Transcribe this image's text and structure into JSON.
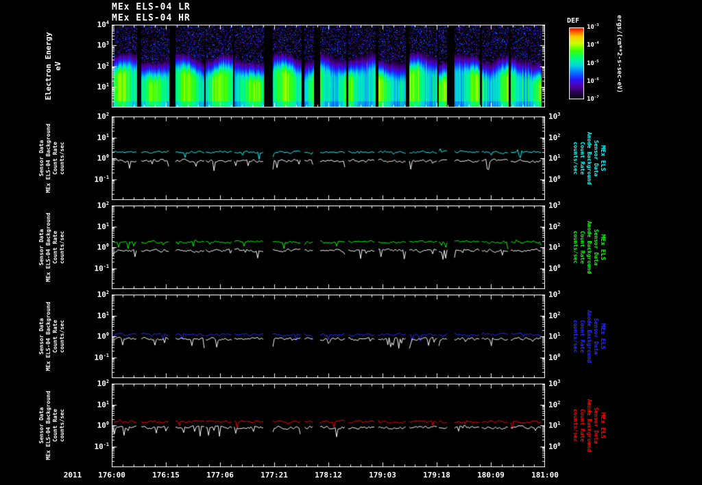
{
  "titles": {
    "lr": "MEx ELS-04 LR",
    "hr": "MEx ELS-04 HR"
  },
  "chart_data": {
    "layout": "5 stacked time-series panels sharing one x axis (day:hour of 2011)",
    "x_axis": {
      "year": "2011",
      "tick_labels": [
        "176:00",
        "176:15",
        "177:06",
        "177:21",
        "178:12",
        "179:03",
        "179:18",
        "180:09",
        "181:00"
      ]
    },
    "time_segments": [
      [
        0.003,
        0.059
      ],
      [
        0.068,
        0.133
      ],
      [
        0.147,
        0.214
      ],
      [
        0.217,
        0.28
      ],
      [
        0.283,
        0.351
      ],
      [
        0.372,
        0.438
      ],
      [
        0.445,
        0.467
      ],
      [
        0.481,
        0.541
      ],
      [
        0.546,
        0.609
      ],
      [
        0.615,
        0.679
      ],
      [
        0.687,
        0.752
      ],
      [
        0.755,
        0.774
      ],
      [
        0.791,
        0.85
      ],
      [
        0.854,
        0.916
      ],
      [
        0.921,
        0.992
      ]
    ],
    "spectrogram": {
      "type": "heatmap",
      "axis_title_lines": [
        "Electron Energy",
        "eV"
      ],
      "y_tick_labels": [
        "10^4",
        "10^3",
        "10^2",
        "10^1"
      ],
      "y_range_log10_eV": [
        0,
        4
      ],
      "flux_profile": {
        "bright_band_log10_eV_range": [
          0,
          1.5
        ],
        "peak_energy_log10_eV": 1.0,
        "falloff_sigma_log10": 0.55,
        "speckle_noise_above_log10_eV": 2.4
      },
      "colorbar": {
        "label": "DEF",
        "tick_labels": [
          "10^-3",
          "10^-4",
          "10^-5",
          "10^-6",
          "10^-7"
        ],
        "unit": "ergs/(cm**2-s-sec-eV)",
        "range_log10": [
          -7,
          -3
        ]
      }
    },
    "line_panels": [
      {
        "type": "line",
        "color": "#00ffff",
        "left_tick_labels": [
          "10^2",
          "10^1",
          "10^0",
          "10^-1"
        ],
        "right_tick_labels": [
          "10^3",
          "10^2",
          "10^1",
          "10^0"
        ],
        "left_axis_title_lines": [
          "Sensor Data",
          "MEx ELS-04 Background",
          "Count Rate",
          "counts/sec"
        ],
        "right_axis_title_lines": [
          "MEx ELS",
          "Sensor Data",
          "Anode Background",
          "Count Rate",
          "counts/sec"
        ],
        "series": [
          {
            "name": "anode background count rate",
            "color": "#00ffff",
            "approx_level_counts_per_sec": 2.0
          },
          {
            "name": "sensor background count rate",
            "color": "#ffffff",
            "approx_level_counts_per_sec": 0.75
          }
        ]
      },
      {
        "type": "line",
        "color": "#00ff00",
        "left_tick_labels": [
          "10^2",
          "10^1",
          "10^0",
          "10^-1"
        ],
        "right_tick_labels": [
          "10^3",
          "10^2",
          "10^1",
          "10^0"
        ],
        "left_axis_title_lines": [
          "Sensor Data",
          "MEx ELS-04 Background",
          "Count Rate",
          "counts/sec"
        ],
        "right_axis_title_lines": [
          "MEx ELS",
          "Sensor Data",
          "Anode Background",
          "Count Rate",
          "counts/sec"
        ],
        "series": [
          {
            "name": "anode background count rate",
            "color": "#00ff00",
            "approx_level_counts_per_sec": 1.8
          },
          {
            "name": "sensor background count rate",
            "color": "#ffffff",
            "approx_level_counts_per_sec": 0.7
          }
        ]
      },
      {
        "type": "line",
        "color": "#2a2aff",
        "left_tick_labels": [
          "10^2",
          "10^1",
          "10^0",
          "10^-1"
        ],
        "right_tick_labels": [
          "10^3",
          "10^2",
          "10^1",
          "10^0"
        ],
        "left_axis_title_lines": [
          "Sensor Data",
          "MEx ELS-04 Background",
          "Count Rate",
          "counts/sec"
        ],
        "right_axis_title_lines": [
          "MEx ELS",
          "Sensor Data",
          "Anode Background",
          "Count Rate",
          "counts/sec"
        ],
        "series": [
          {
            "name": "anode background count rate",
            "color": "#2a2aff",
            "approx_level_counts_per_sec": 1.2
          },
          {
            "name": "sensor background count rate",
            "color": "#ffffff",
            "approx_level_counts_per_sec": 0.75
          }
        ]
      },
      {
        "type": "line",
        "color": "#ff0000",
        "left_tick_labels": [
          "10^2",
          "10^1",
          "10^0",
          "10^-1"
        ],
        "right_tick_labels": [
          "10^3",
          "10^2",
          "10^1",
          "10^0"
        ],
        "left_axis_title_lines": [
          "Sensor Data",
          "MEx ELS-04 Background",
          "Count Rate",
          "counts/sec"
        ],
        "right_axis_title_lines": [
          "MEx ELS",
          "Sensor Data",
          "Anode Background",
          "Count Rate",
          "counts/sec"
        ],
        "series": [
          {
            "name": "anode background count rate",
            "color": "#ff0000",
            "approx_level_counts_per_sec": 1.5
          },
          {
            "name": "sensor background count rate",
            "color": "#ffffff",
            "approx_level_counts_per_sec": 0.8
          }
        ]
      }
    ]
  }
}
